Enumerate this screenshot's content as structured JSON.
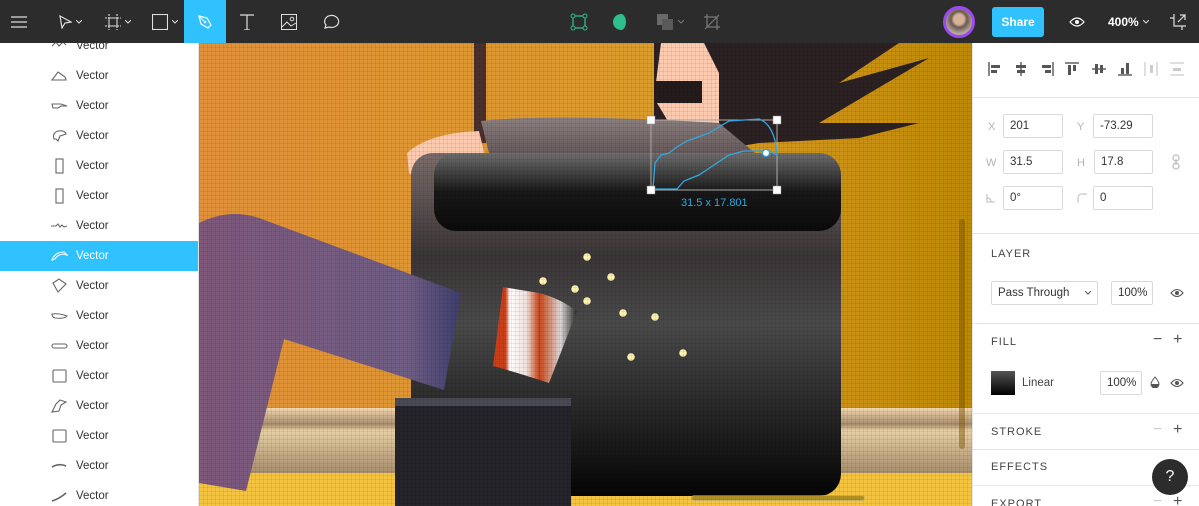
{
  "toolbar": {
    "tools": [
      {
        "name": "menu",
        "icon": "hamburger-menu-icon"
      },
      {
        "name": "move",
        "icon": "move-arrow-icon"
      },
      {
        "name": "frame",
        "icon": "frame-icon"
      },
      {
        "name": "shape",
        "icon": "rectangle-icon"
      },
      {
        "name": "pen",
        "icon": "pen-icon",
        "active": true
      },
      {
        "name": "text",
        "icon": "text-icon"
      },
      {
        "name": "image",
        "icon": "image-icon"
      },
      {
        "name": "comment",
        "icon": "comment-icon"
      }
    ],
    "center_tools": [
      "edit-object-icon",
      "mask-icon",
      "boolean-icon",
      "crop-icon"
    ],
    "share_label": "Share",
    "zoom_level": "400%",
    "accent": "#30c2ff",
    "avatar_ring": "#9d49f0"
  },
  "layers": {
    "items": [
      {
        "label": "Vector",
        "icon": "vector-icon"
      },
      {
        "label": "Vector",
        "icon": "vector-triangle-icon"
      },
      {
        "label": "Vector",
        "icon": "vector-arm-icon"
      },
      {
        "label": "Vector",
        "icon": "vector-hand-icon"
      },
      {
        "label": "Vector",
        "icon": "vector-rect-tall-icon"
      },
      {
        "label": "Vector",
        "icon": "vector-rect-tall-icon"
      },
      {
        "label": "Vector",
        "icon": "vector-zigzag-icon"
      },
      {
        "label": "Vector",
        "icon": "vector-curve-icon",
        "selected": true
      },
      {
        "label": "Vector",
        "icon": "vector-diamond-icon"
      },
      {
        "label": "Vector",
        "icon": "vector-pill-icon"
      },
      {
        "label": "Vector",
        "icon": "vector-bar-icon"
      },
      {
        "label": "Vector",
        "icon": "vector-square-icon"
      },
      {
        "label": "Vector",
        "icon": "vector-leg-icon"
      },
      {
        "label": "Vector",
        "icon": "vector-square-icon"
      },
      {
        "label": "Vector",
        "icon": "vector-line-icon"
      },
      {
        "label": "Vector",
        "icon": "vector-slash-icon"
      }
    ]
  },
  "canvas": {
    "selection_size_label": "31.5 x 17.801",
    "selection_color": "#30a8e0"
  },
  "properties": {
    "x_label": "X",
    "x_value": "201",
    "y_label": "Y",
    "y_value": "-73.29",
    "w_label": "W",
    "w_value": "31.5",
    "h_label": "H",
    "h_value": "17.8",
    "rotation_value": "0°",
    "radius_value": "0",
    "layer": {
      "title": "LAYER",
      "blend_mode": "Pass Through",
      "opacity": "100%"
    },
    "fill": {
      "title": "FILL",
      "type": "Linear",
      "opacity": "100%"
    },
    "stroke_title": "STROKE",
    "effects_title": "EFFECTS",
    "export_title": "EXPORT"
  },
  "help_label": "?"
}
